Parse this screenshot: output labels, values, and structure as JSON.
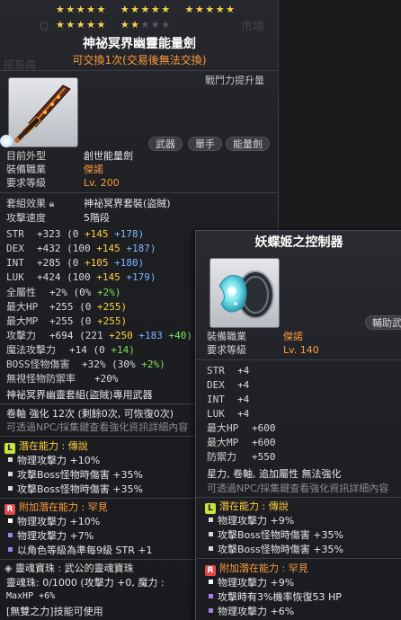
{
  "weapon": {
    "star_rows": [
      [
        "★★★★★",
        "★★★★★",
        "★★★★★"
      ],
      [
        "★★★★★",
        "★★",
        "★★★"
      ]
    ],
    "ghost_bg_left": "Q",
    "ghost_bg_right": "市場",
    "ghost_bg_name": "挖島曲",
    "title": "神祕冥界幽靈能量劍",
    "tradable": "可交換1次(交易後無法交換)",
    "combat_power_label": "戰鬥力提升量",
    "tags": [
      "武器",
      "單手",
      "能量劍"
    ],
    "info": [
      {
        "label": "目前外型",
        "value": "創世能量劍"
      },
      {
        "label": "裝備職業",
        "value": "傑諾"
      },
      {
        "label": "要求等級",
        "value": "Lv. 200"
      }
    ],
    "set_label": "套組效果",
    "set_value": "神祕冥界套裝(盜賊)",
    "speed_label": "攻擊速度",
    "speed_value": "5階段",
    "stats": [
      {
        "k": "STR",
        "total": "+323",
        "a": "(0",
        "b": "+145",
        "c": "+178)"
      },
      {
        "k": "DEX",
        "total": "+432",
        "a": "(100",
        "b": "+145",
        "c": "+187)"
      },
      {
        "k": "INT",
        "total": "+285",
        "a": "(0",
        "b": "+105",
        "c": "+180)"
      },
      {
        "k": "LUK",
        "total": "+424",
        "a": "(100",
        "b": "+145",
        "c": "+179)"
      }
    ],
    "allstat": {
      "k": "全屬性",
      "total": "+2%",
      "a": "(0%",
      "b": "+2%)"
    },
    "hp": {
      "k": "最大HP",
      "total": "+255",
      "a": "(0",
      "b": "+255)"
    },
    "mp": {
      "k": "最大MP",
      "total": "+255",
      "a": "(0",
      "b": "+255)"
    },
    "atk": {
      "k": "攻擊力",
      "total": "+694",
      "a": "(221",
      "b": "+250",
      "c": "+183",
      "d": "+40)"
    },
    "matk": {
      "k": "魔法攻擊力",
      "total": "+14",
      "a": "(0",
      "b": "+14)"
    },
    "boss": {
      "k": "BOSS怪物傷害",
      "total": "+32%",
      "a": "(30%",
      "b": "+2%)"
    },
    "ignore": {
      "k": "無視怪物防禦率",
      "total": "+20%"
    },
    "exclusive": "神祕冥界幽靈套組(盜賊)專用武器",
    "scroll_line": "卷軸 強化 12次 (剩餘0次, 可恢復0次)",
    "npc_line": "可透過NPC/採集鍵查看強化資訊詳細內容",
    "potential": {
      "title": "潛在能力 : 傳說",
      "rank_icon": "L",
      "lines": [
        "物理攻擊力 +10%",
        "攻擊Boss怪物時傷害 +35%",
        "攻擊Boss怪物時傷害 +35%"
      ]
    },
    "additional": {
      "title": "附加潛在能力 : 罕見",
      "rank_icon": "R",
      "lines": [
        "物理攻擊力 +10%",
        "物理攻擊力 +7%",
        "以角色等級為準每9級 STR +1"
      ]
    },
    "soul_title": "靈魂寶珠 : 武公的靈魂寶珠",
    "soul_line": "靈魂珠: 0/1000 (攻擊力 +0, 魔力 :",
    "maxhp_line": "MaxHP +6%",
    "skill_line": "[無雙之力]技能可使用"
  },
  "controller": {
    "title": "妖蝶姬之控制器",
    "tag": "輔助武",
    "info": [
      {
        "label": "裝備職業",
        "value": "傑諾"
      },
      {
        "label": "要求等級",
        "value": "Lv. 140"
      }
    ],
    "stats": [
      {
        "k": "STR",
        "v": "+4"
      },
      {
        "k": "DEX",
        "v": "+4"
      },
      {
        "k": "INT",
        "v": "+4"
      },
      {
        "k": "LUK",
        "v": "+4"
      },
      {
        "k": "最大HP",
        "v": "+600"
      },
      {
        "k": "最大MP",
        "v": "+600"
      },
      {
        "k": "防禦力",
        "v": "+550"
      }
    ],
    "enhance_line": "星力, 卷軸, 追加屬性 無法強化",
    "npc_line": "可透過NPC/採集鍵查看強化資訊詳細內容",
    "potential": {
      "title": "潛在能力 : 傳說",
      "rank_icon": "L",
      "lines": [
        "物理攻擊力 +9%",
        "攻擊Boss怪物時傷害 +35%",
        "攻擊Boss怪物時傷害 +35%"
      ]
    },
    "additional": {
      "title": "附加潛在能力 : 罕見",
      "rank_icon": "R",
      "lines": [
        "物理攻擊力 +9%",
        "攻擊時有3%機率恢復53 HP",
        "物理攻擊力 +6%"
      ]
    }
  },
  "colors": {
    "legend_green": "#c8e23c",
    "rare_red": "#e04a4a",
    "orange": "#ff9c3d",
    "yellow": "#ffd13c",
    "green": "#7fe05c",
    "blue": "#7bb6ff",
    "star": "#f6d44c"
  }
}
